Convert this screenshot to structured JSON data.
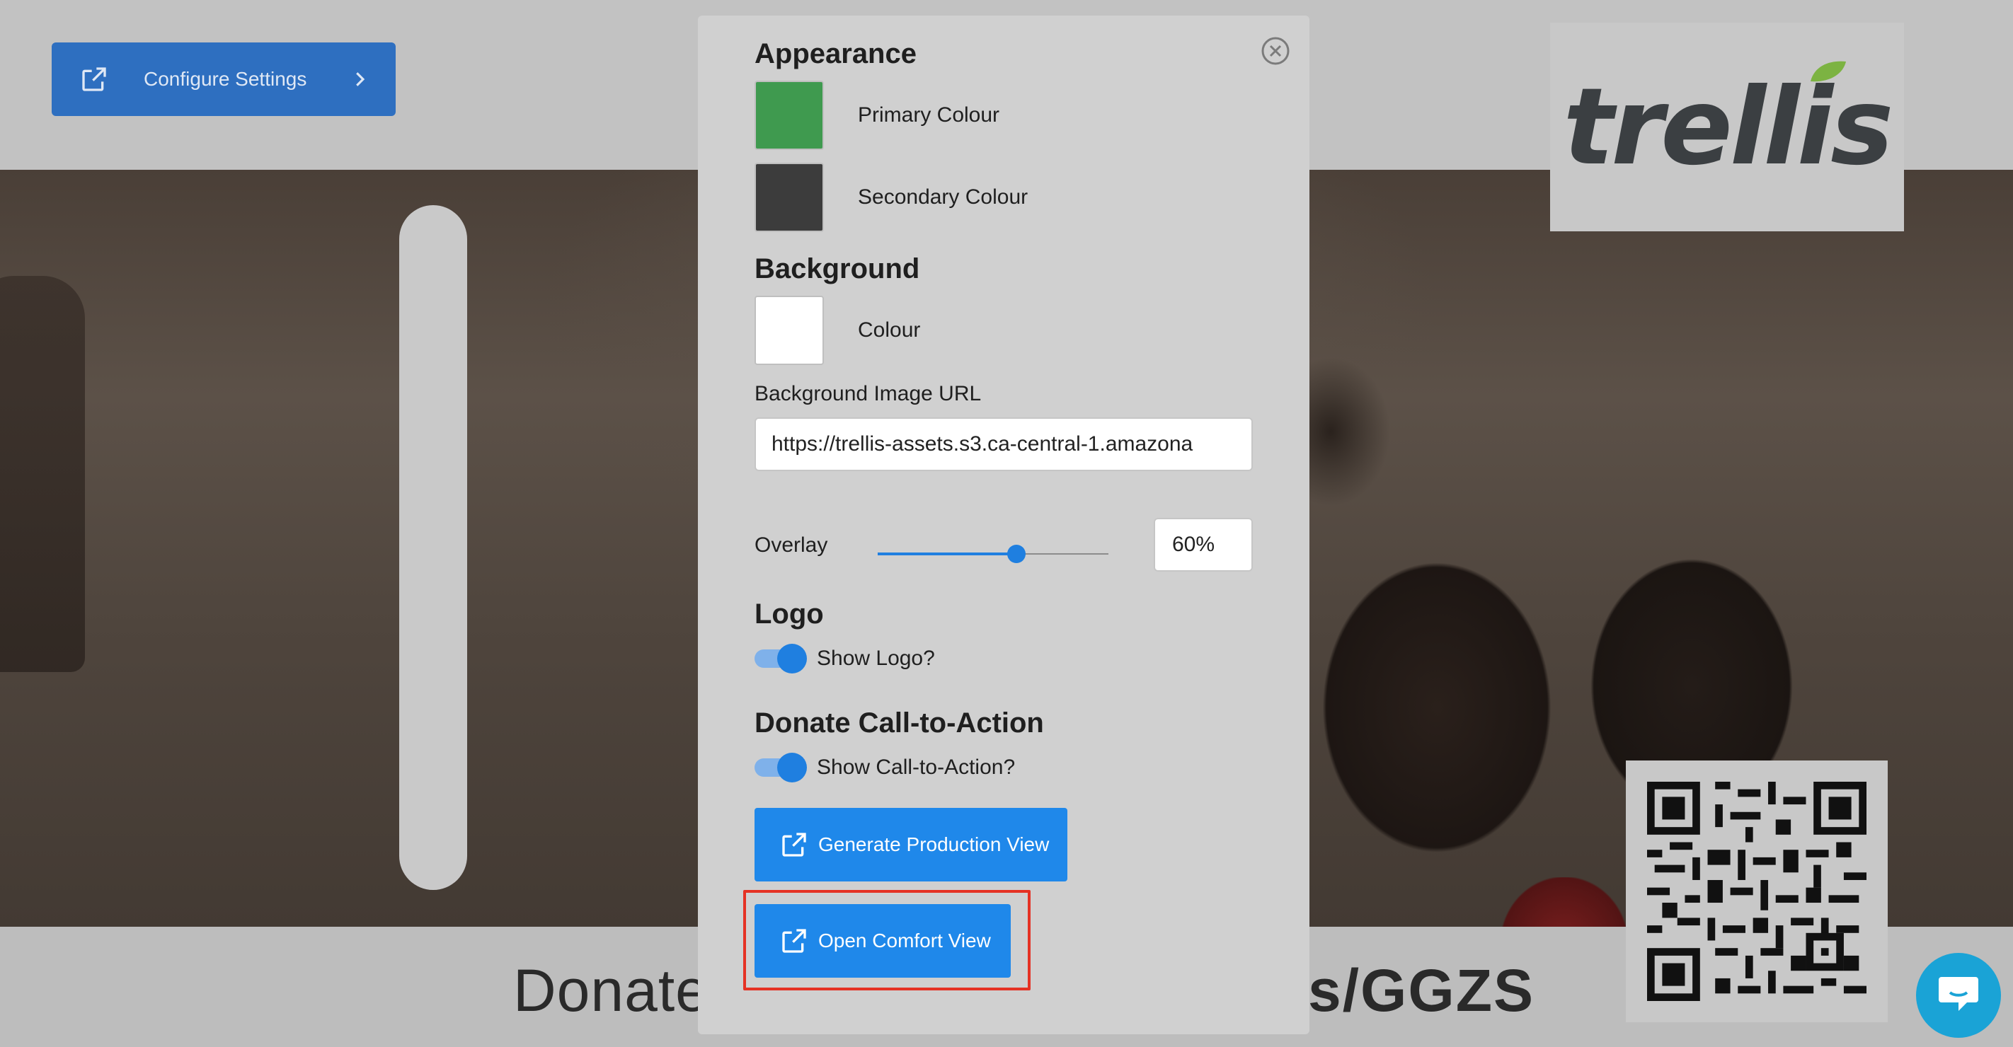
{
  "header": {
    "configure_label": "Configure Settings",
    "configure_icon": "external-link-icon",
    "chevron_icon": "chevron-right-icon"
  },
  "brand": {
    "logo_text": "trellis",
    "logo_color": "#3b3f42",
    "leaf_color": "#7cb342"
  },
  "footer": {
    "donate_left": "Donate",
    "donate_right": "s/GGZS"
  },
  "modal": {
    "appearance": {
      "heading": "Appearance",
      "primary_label": "Primary Colour",
      "primary_color": "#3f9a4f",
      "secondary_label": "Secondary Colour",
      "secondary_color": "#3c3c3c"
    },
    "background": {
      "heading": "Background",
      "colour_label": "Colour",
      "colour_value": "#ffffff",
      "image_url_label": "Background Image URL",
      "image_url_value": "https://trellis-assets.s3.ca-central-1.amazona"
    },
    "overlay": {
      "label": "Overlay",
      "value_percent": 60,
      "display": "60%"
    },
    "logo": {
      "heading": "Logo",
      "toggle_label": "Show Logo?",
      "enabled": true
    },
    "cta": {
      "heading": "Donate Call-to-Action",
      "toggle_label": "Show Call-to-Action?",
      "enabled": true
    },
    "buttons": {
      "generate": "Generate Production View",
      "comfort": "Open Comfort View"
    },
    "accent_color": "#1f88ea"
  }
}
